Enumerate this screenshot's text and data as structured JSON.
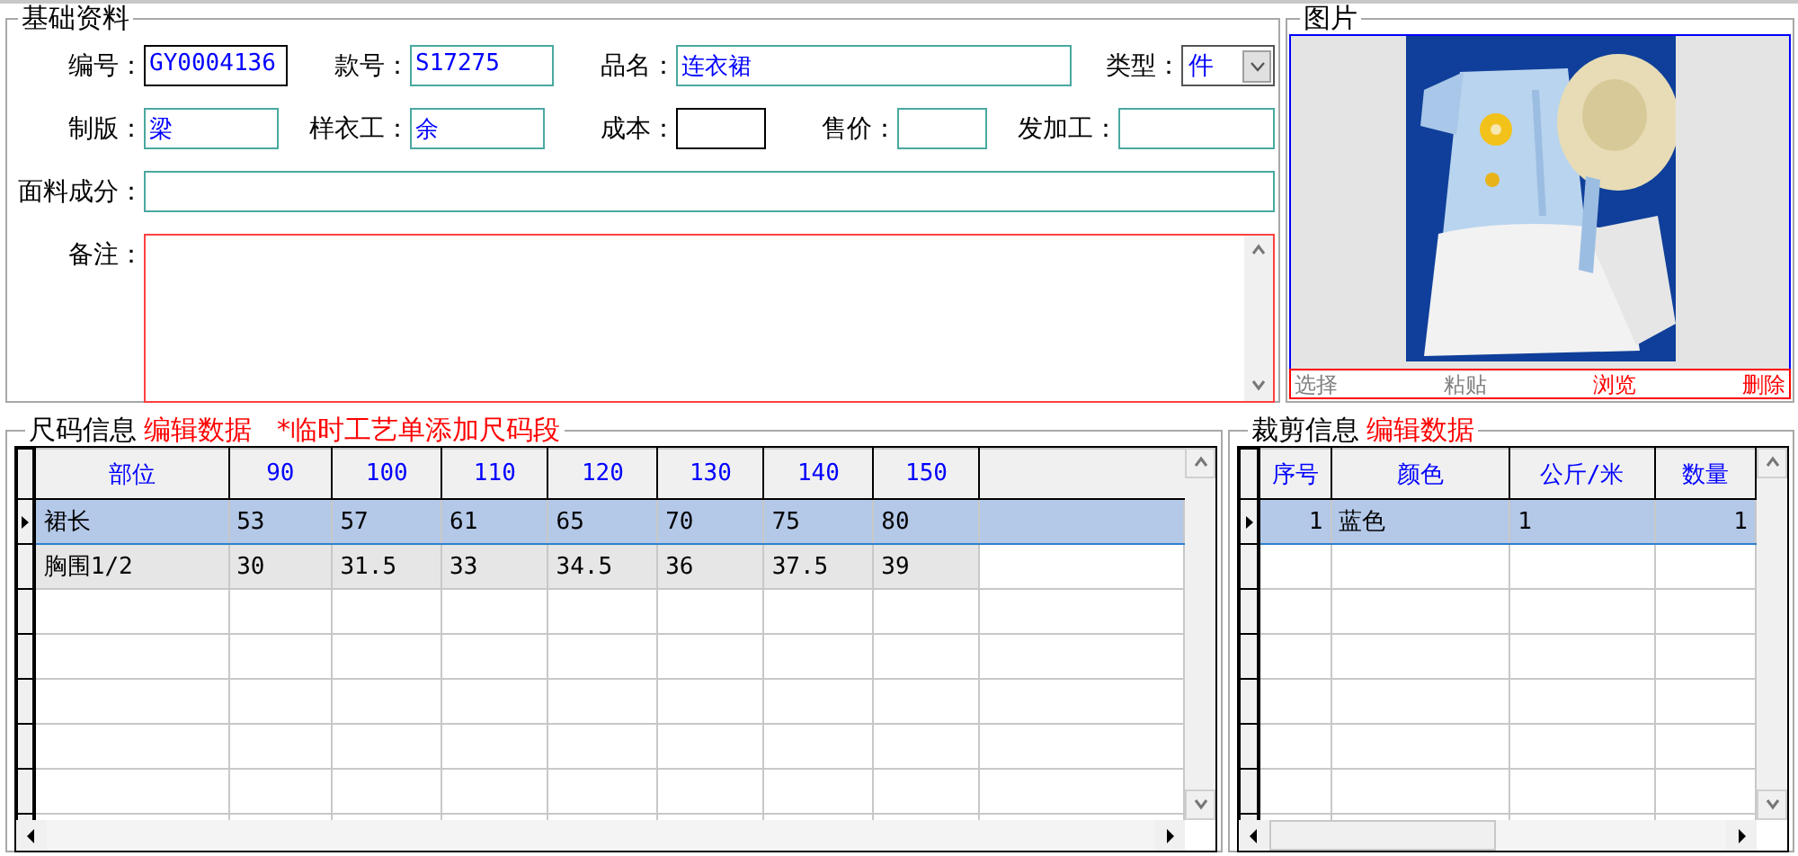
{
  "basic_info": {
    "title": "基础资料",
    "rows": [
      [
        {
          "label": "编号：",
          "value": "GY0004136",
          "kind": "text"
        },
        {
          "label": "款号：",
          "value": "S17275",
          "kind": "text"
        },
        {
          "label": "品名：",
          "value": "连衣裙",
          "kind": "text"
        },
        {
          "label": "类型：",
          "value": "件",
          "kind": "select"
        }
      ],
      [
        {
          "label": "制版：",
          "value": "梁",
          "kind": "text"
        },
        {
          "label": "样衣工：",
          "value": "余",
          "kind": "text"
        },
        {
          "label": "成本：",
          "kind": "text"
        },
        {
          "label": "售价：",
          "kind": "text"
        },
        {
          "label": "发加工：",
          "kind": "text"
        }
      ],
      [
        {
          "label": "面料成分：",
          "kind": "text"
        }
      ],
      [
        {
          "label": "备注：",
          "kind": "textarea"
        }
      ]
    ]
  },
  "picture_panel": {
    "title": "图片",
    "buttons": [
      {
        "label": "选择",
        "color": "#808080"
      },
      {
        "label": "粘贴",
        "color": "#808080"
      },
      {
        "label": "浏览",
        "color": "#ff0000"
      },
      {
        "label": "删除",
        "color": "#ff0000"
      }
    ]
  },
  "size_info": {
    "title": "尺码信息",
    "edit_link": "编辑数据",
    "note": "*临时工艺单添加尺码段",
    "columns": [
      "部位",
      "90",
      "100",
      "110",
      "120",
      "130",
      "140",
      "150"
    ],
    "rows": [
      {
        "selected": true,
        "cells": [
          "裙长",
          "53",
          "57",
          "61",
          "65",
          "70",
          "75",
          "80"
        ]
      },
      {
        "selected": false,
        "cells": [
          "胸围1/2",
          "30",
          "31.5",
          "33",
          "34.5",
          "36",
          "37.5",
          "39"
        ]
      }
    ]
  },
  "cutting_info": {
    "title": "裁剪信息",
    "edit_link": "编辑数据",
    "columns": [
      "序号",
      "颜色",
      "公斤/米",
      "数量"
    ],
    "rows": [
      {
        "selected": true,
        "cells": [
          "1",
          "蓝色",
          "1",
          "1"
        ]
      }
    ]
  }
}
